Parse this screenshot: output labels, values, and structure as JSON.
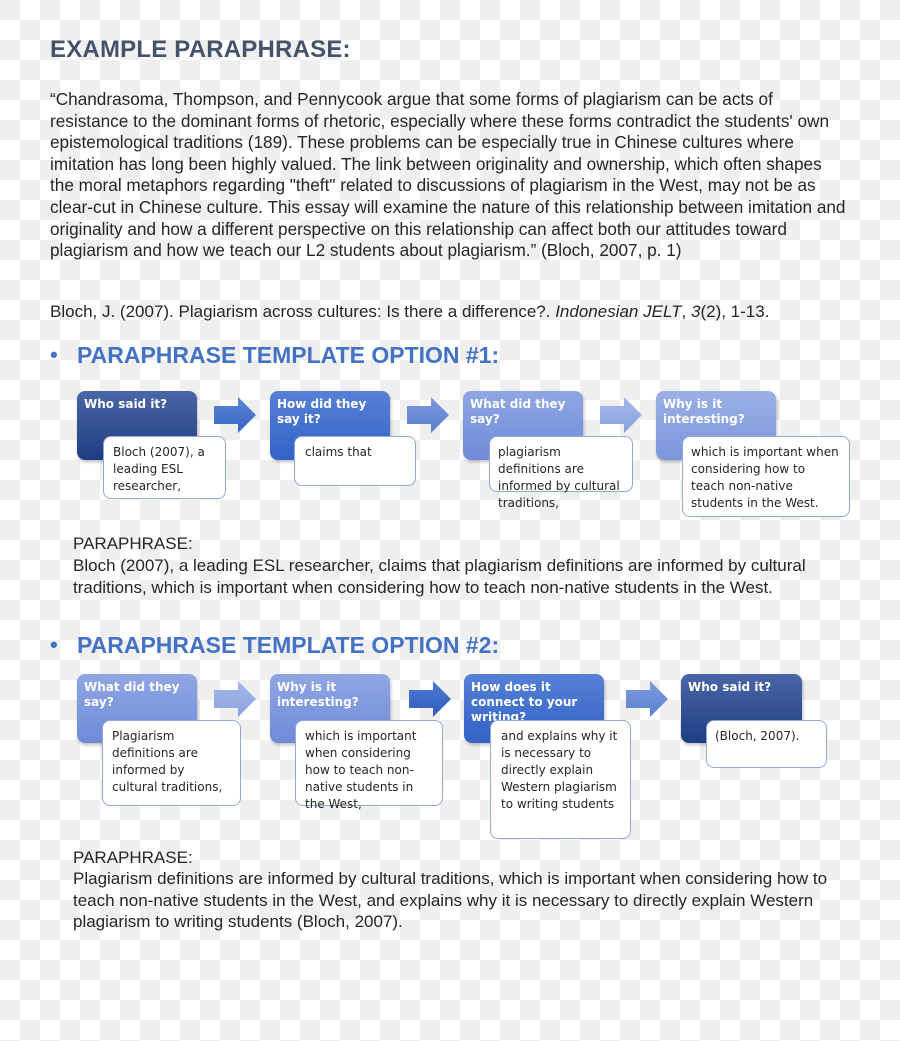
{
  "heading": "EXAMPLE PARAPHRASE:",
  "quote": "“Chandrasoma, Thompson, and Pennycook argue that some forms of plagiarism can be acts of resistance to the dominant forms of rhetoric, especially where these forms contradict the students' own epistemological traditions (189). These problems can be especially true in Chinese cultures where imitation has long been highly valued. The link between originality and ownership, which often shapes the moral metaphors regarding \"theft\" related to discussions of plagiarism in the West, may not be as clear-cut in Chinese culture. This essay will examine the nature of this relationship between imitation and originality and how a different perspective on this relationship can affect both our attitudes toward plagiarism and how we teach our L2 students about plagiarism.” (Bloch, 2007, p. 1)",
  "reference": {
    "prefix": "Bloch, J. (2007). Plagiarism across cultures: Is there a difference?. ",
    "journal": "Indonesian JELT",
    "sep": ", ",
    "volume": "3",
    "rest": "(2), 1-13."
  },
  "bullet": "•",
  "option1": {
    "title": "PARAPHRASE TEMPLATE OPTION #1:",
    "steps": [
      {
        "header": "Who said it?",
        "text": "Bloch (2007), a leading ESL researcher,"
      },
      {
        "header": "How did they say it?",
        "text": "claims that"
      },
      {
        "header": "What did they say?",
        "text": "plagiarism definitions are informed by cultural traditions,"
      },
      {
        "header": "Why is it interesting?",
        "text": "which is important when considering how to teach non-native students in the West."
      }
    ],
    "paraphrase_label": "PARAPHRASE:",
    "paraphrase": "Bloch (2007), a leading ESL researcher, claims that plagiarism definitions are informed by cultural traditions, which is important when considering how to teach non-native students in the West."
  },
  "option2": {
    "title": "PARAPHRASE TEMPLATE OPTION #2:",
    "steps": [
      {
        "header": "What did they say?",
        "text": "Plagiarism definitions are informed by cultural traditions,"
      },
      {
        "header": "Why is it interesting?",
        "text": "which is important when considering how to teach non-native students in the West,"
      },
      {
        "header": "How does it connect to your writing?",
        "text": "and explains why it is necessary to directly explain Western plagiarism to writing students"
      },
      {
        "header": "Who said it?",
        "text": "(Bloch, 2007)."
      }
    ],
    "paraphrase_label": "PARAPHRASE:",
    "paraphrase": "Plagiarism definitions are informed by cultural traditions, which is important when considering how to teach non-native students in the West, and explains why it is necessary to directly explain Western plagiarism to writing students (Bloch, 2007)."
  }
}
